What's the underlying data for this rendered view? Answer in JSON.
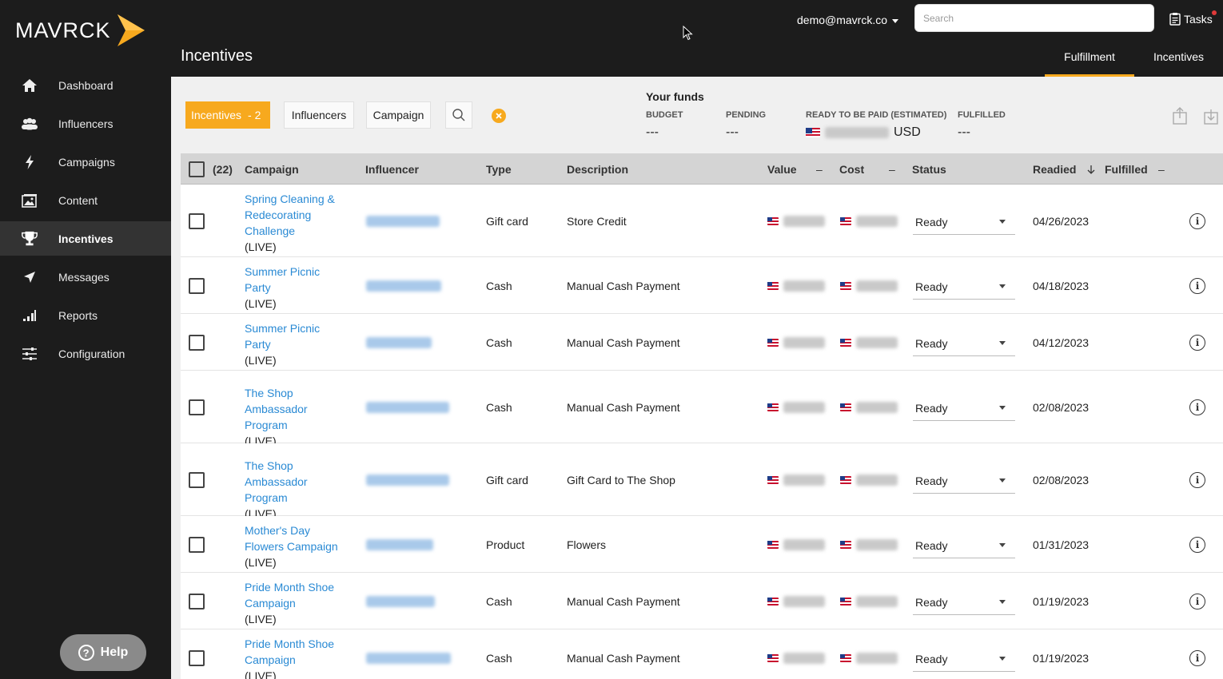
{
  "brand": {
    "name": "MAVRCK",
    "accent": "#f7a91e"
  },
  "header": {
    "page_title": "Incentives",
    "user_email": "demo@mavrck.co",
    "search_placeholder": "Search",
    "tasks_label": "Tasks",
    "tabs": [
      {
        "label": "Fulfillment",
        "active": true
      },
      {
        "label": "Incentives",
        "active": false
      }
    ]
  },
  "sidebar": {
    "items": [
      {
        "label": "Dashboard",
        "icon": "home-icon"
      },
      {
        "label": "Influencers",
        "icon": "users-icon"
      },
      {
        "label": "Campaigns",
        "icon": "bolt-icon"
      },
      {
        "label": "Content",
        "icon": "image-icon"
      },
      {
        "label": "Incentives",
        "icon": "trophy-icon",
        "active": true
      },
      {
        "label": "Messages",
        "icon": "send-icon"
      },
      {
        "label": "Reports",
        "icon": "bar-chart-icon"
      },
      {
        "label": "Configuration",
        "icon": "sliders-icon"
      }
    ],
    "help_label": "Help"
  },
  "filters": {
    "incentives_label": "Incentives",
    "incentives_count": "- 2",
    "influencers_label": "Influencers",
    "campaign_label": "Campaign"
  },
  "funds": {
    "title": "Your funds",
    "budget_label": "BUDGET",
    "budget_value": "---",
    "pending_label": "PENDING",
    "pending_value": "---",
    "ready_label": "READY TO BE PAID (ESTIMATED)",
    "ready_currency": "USD",
    "fulfilled_label": "FULFILLED",
    "fulfilled_value": "---"
  },
  "table": {
    "count": "(22)",
    "columns": {
      "campaign": "Campaign",
      "influencer": "Influencer",
      "type": "Type",
      "description": "Description",
      "value": "Value",
      "value_sort": "–",
      "cost": "Cost",
      "cost_sort": "–",
      "status": "Status",
      "readied": "Readied",
      "fulfilled": "Fulfilled",
      "fulfilled_sort": "–"
    },
    "rows": [
      {
        "campaign": "Spring Cleaning & Redecorating Challenge",
        "state": "(LIVE)",
        "type": "Gift card",
        "description": "Store Credit",
        "status": "Ready",
        "readied": "04/26/2023"
      },
      {
        "campaign": "Summer Picnic Party",
        "state": "(LIVE)",
        "type": "Cash",
        "description": "Manual Cash Payment",
        "status": "Ready",
        "readied": "04/18/2023"
      },
      {
        "campaign": "Summer Picnic Party",
        "state": "(LIVE)",
        "type": "Cash",
        "description": "Manual Cash Payment",
        "status": "Ready",
        "readied": "04/12/2023"
      },
      {
        "campaign": "The Shop Ambassador Program",
        "state": "(LIVE)",
        "type": "Cash",
        "description": "Manual Cash Payment",
        "status": "Ready",
        "readied": "02/08/2023"
      },
      {
        "campaign": "The Shop Ambassador Program",
        "state": "(LIVE)",
        "type": "Gift card",
        "description": "Gift Card to The Shop",
        "status": "Ready",
        "readied": "02/08/2023"
      },
      {
        "campaign": "Mother's Day Flowers Campaign",
        "state": "(LIVE)",
        "type": "Product",
        "description": "Flowers",
        "status": "Ready",
        "readied": "01/31/2023"
      },
      {
        "campaign": "Pride Month Shoe Campaign",
        "state": "(LIVE)",
        "type": "Cash",
        "description": "Manual Cash Payment",
        "status": "Ready",
        "readied": "01/19/2023"
      },
      {
        "campaign": "Pride Month Shoe Campaign",
        "state": "(LIVE)",
        "type": "Cash",
        "description": "Manual Cash Payment",
        "status": "Ready",
        "readied": "01/19/2023"
      }
    ]
  }
}
